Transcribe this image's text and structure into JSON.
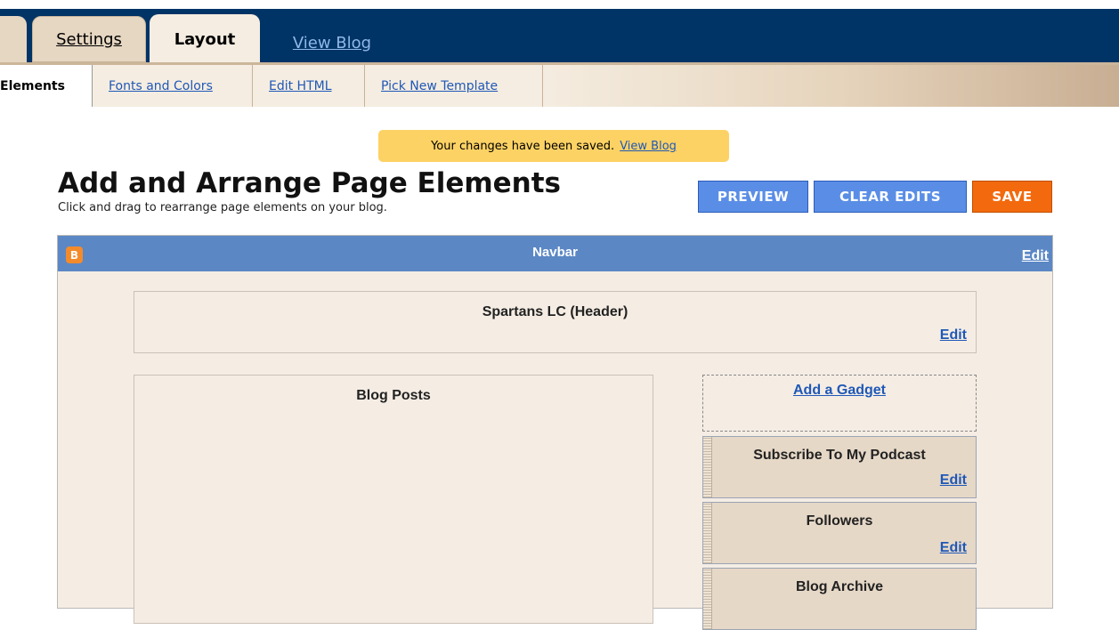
{
  "tabs": {
    "settings": "Settings",
    "layout": "Layout",
    "view_blog": "View Blog"
  },
  "subnav": {
    "elements": "Elements",
    "fonts": "Fonts and Colors",
    "edit_html": "Edit HTML",
    "pick_template": "Pick New Template"
  },
  "notice": {
    "text": "Your changes have been saved.",
    "link": "View Blog"
  },
  "page": {
    "title": "Add and Arrange Page Elements",
    "subtitle": "Click and drag to rearrange page elements on your blog."
  },
  "buttons": {
    "preview": "PREVIEW",
    "clear": "CLEAR EDITS",
    "save": "SAVE"
  },
  "navbar": {
    "icon": "B",
    "title": "Navbar",
    "edit": "Edit"
  },
  "header_widget": {
    "title": "Spartans LC (Header)",
    "edit": "Edit"
  },
  "blog_posts": {
    "title": "Blog Posts"
  },
  "add_gadget": "Add a Gadget",
  "sidebar": [
    {
      "title": "Subscribe To My Podcast",
      "edit": "Edit"
    },
    {
      "title": "Followers",
      "edit": "Edit"
    },
    {
      "title": "Blog Archive"
    }
  ]
}
